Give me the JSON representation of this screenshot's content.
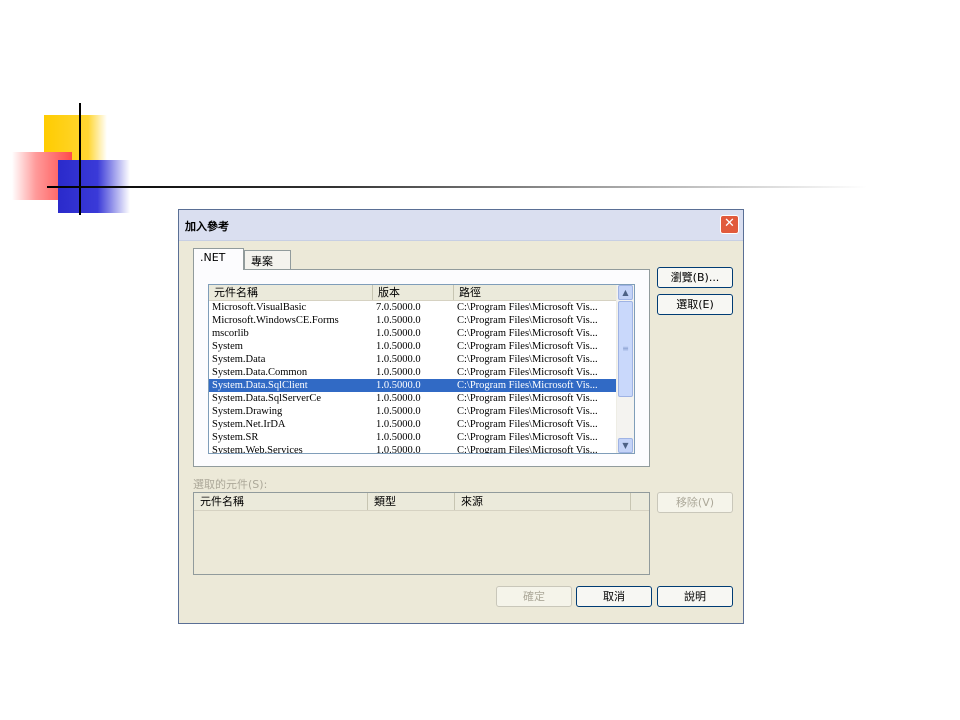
{
  "dialog": {
    "title": "加入參考",
    "close_glyph": "✕",
    "tabs": [
      {
        "label": ".NET",
        "active": true
      },
      {
        "label": "專案",
        "active": false
      }
    ],
    "components": {
      "columns": [
        "元件名稱",
        "版本",
        "路徑"
      ],
      "rows": [
        {
          "name": "Microsoft.VisualBasic",
          "version": "7.0.5000.0",
          "path": "C:\\Program Files\\Microsoft Vis...",
          "selected": false
        },
        {
          "name": "Microsoft.WindowsCE.Forms",
          "version": "1.0.5000.0",
          "path": "C:\\Program Files\\Microsoft Vis...",
          "selected": false
        },
        {
          "name": "mscorlib",
          "version": "1.0.5000.0",
          "path": "C:\\Program Files\\Microsoft Vis...",
          "selected": false
        },
        {
          "name": "System",
          "version": "1.0.5000.0",
          "path": "C:\\Program Files\\Microsoft Vis...",
          "selected": false
        },
        {
          "name": "System.Data",
          "version": "1.0.5000.0",
          "path": "C:\\Program Files\\Microsoft Vis...",
          "selected": false
        },
        {
          "name": "System.Data.Common",
          "version": "1.0.5000.0",
          "path": "C:\\Program Files\\Microsoft Vis...",
          "selected": false
        },
        {
          "name": "System.Data.SqlClient",
          "version": "1.0.5000.0",
          "path": "C:\\Program Files\\Microsoft Vis...",
          "selected": true
        },
        {
          "name": "System.Data.SqlServerCe",
          "version": "1.0.5000.0",
          "path": "C:\\Program Files\\Microsoft Vis...",
          "selected": false
        },
        {
          "name": "System.Drawing",
          "version": "1.0.5000.0",
          "path": "C:\\Program Files\\Microsoft Vis...",
          "selected": false
        },
        {
          "name": "System.Net.IrDA",
          "version": "1.0.5000.0",
          "path": "C:\\Program Files\\Microsoft Vis...",
          "selected": false
        },
        {
          "name": "System.SR",
          "version": "1.0.5000.0",
          "path": "C:\\Program Files\\Microsoft Vis...",
          "selected": false
        },
        {
          "name": "System.Web.Services",
          "version": "1.0.5000.0",
          "path": "C:\\Program Files\\Microsoft Vis...",
          "selected": false
        }
      ]
    },
    "buttons": {
      "browse": "瀏覽(B)...",
      "select": "選取(E)",
      "remove": "移除(V)",
      "ok": "確定",
      "cancel": "取消",
      "help": "說明"
    },
    "selected_section": {
      "label": "選取的元件(S):",
      "columns": [
        "元件名稱",
        "類型",
        "來源"
      ]
    },
    "scrollbar": {
      "up_icon": "▲",
      "down_icon": "▼",
      "grip_icon": "≡"
    }
  },
  "colors": {
    "dialog_bg": "#ece9d8",
    "selection": "#316ac5",
    "close_button": "#e15a3c"
  }
}
